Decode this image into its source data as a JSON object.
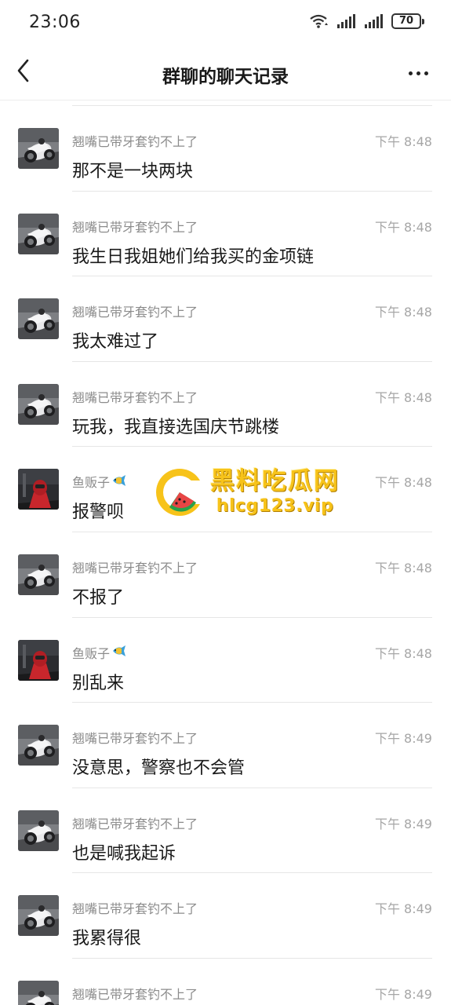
{
  "status_bar": {
    "time": "23:06",
    "battery": "70",
    "icons": [
      "wifi-icon",
      "signal-icon",
      "signal-icon",
      "battery-icon"
    ]
  },
  "nav": {
    "back_icon": "chevron-left-icon",
    "title": "群聊的聊天记录",
    "more_icon": "more-dots-icon"
  },
  "messages": [
    {
      "sender": "翘嘴已带牙套钓不上了",
      "time": "下午 8:48",
      "text": "那不是一块两块",
      "avatar": "motorcycle-avatar"
    },
    {
      "sender": "翘嘴已带牙套钓不上了",
      "time": "下午 8:48",
      "text": "我生日我姐她们给我买的金项链",
      "avatar": "motorcycle-avatar"
    },
    {
      "sender": "翘嘴已带牙套钓不上了",
      "time": "下午 8:48",
      "text": "我太难过了",
      "avatar": "motorcycle-avatar"
    },
    {
      "sender": "翘嘴已带牙套钓不上了",
      "time": "下午 8:48",
      "text": "玩我，我直接选国庆节跳楼",
      "avatar": "motorcycle-avatar"
    },
    {
      "sender": "鱼贩子",
      "time": "下午 8:48",
      "text": "报警呗",
      "avatar": "rider-avatar"
    },
    {
      "sender": "翘嘴已带牙套钓不上了",
      "time": "下午 8:48",
      "text": "不报了",
      "avatar": "motorcycle-avatar"
    },
    {
      "sender": "鱼贩子",
      "time": "下午 8:48",
      "text": "别乱来",
      "avatar": "rider-avatar"
    },
    {
      "sender": "翘嘴已带牙套钓不上了",
      "time": "下午 8:49",
      "text": "没意思，警察也不会管",
      "avatar": "motorcycle-avatar"
    },
    {
      "sender": "翘嘴已带牙套钓不上了",
      "time": "下午 8:49",
      "text": "也是喊我起诉",
      "avatar": "motorcycle-avatar"
    },
    {
      "sender": "翘嘴已带牙套钓不上了",
      "time": "下午 8:49",
      "text": "我累得很",
      "avatar": "motorcycle-avatar"
    },
    {
      "sender": "翘嘴已带牙套钓不上了",
      "time": "下午 8:49",
      "text": "",
      "avatar": "motorcycle-avatar"
    }
  ],
  "watermark": {
    "title": "黑料吃瓜网",
    "url": "hlcg123.vip",
    "logo_icon": "watermelon-logo-icon",
    "color": "#f7c31a"
  }
}
